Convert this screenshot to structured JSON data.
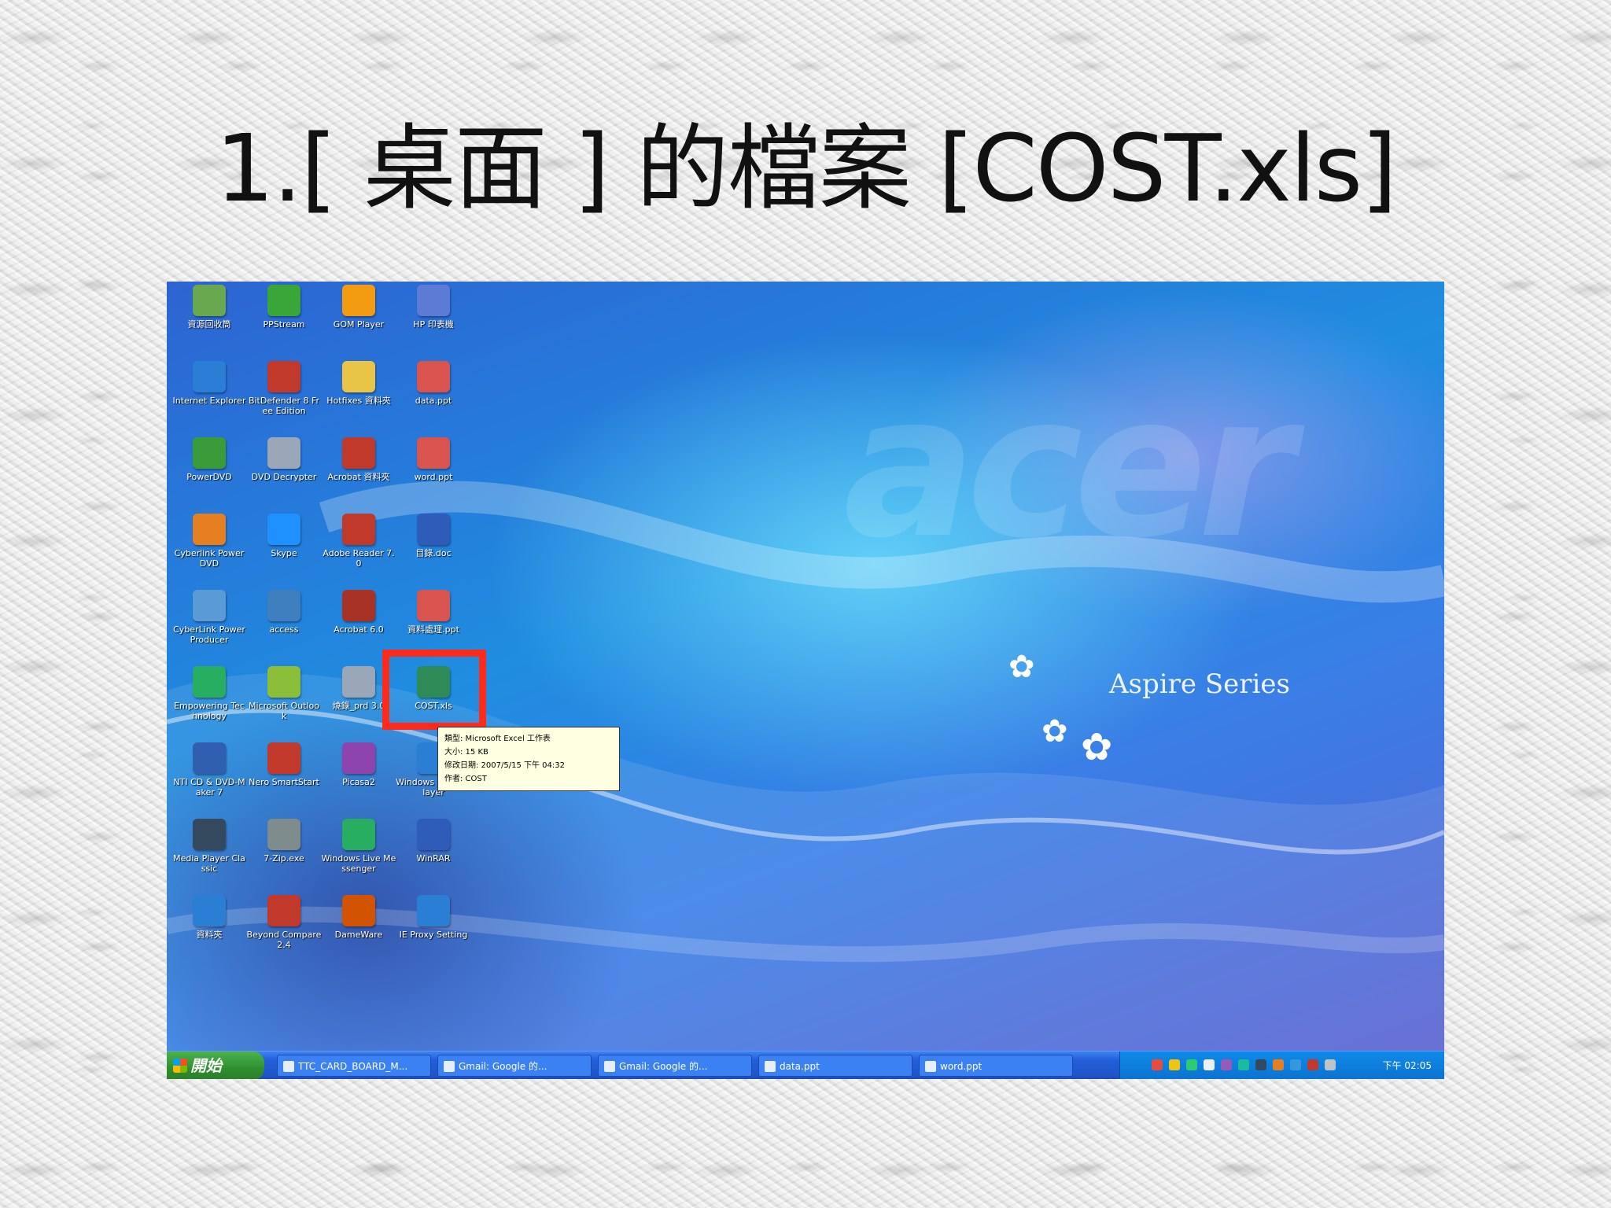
{
  "slide": {
    "title": "1.[ 桌面 ] 的檔案 [COST.xls]"
  },
  "desktop": {
    "brand": "acer",
    "series": "Aspire Series",
    "icons": [
      {
        "label": "資源回收筒",
        "icon": "recycle-bin-icon",
        "color": "#6aa84f"
      },
      {
        "label": "PPStream",
        "icon": "ppstream-icon",
        "color": "#3aa63a"
      },
      {
        "label": "GOM Player",
        "icon": "gom-player-icon",
        "color": "#f39c12"
      },
      {
        "label": "HP 印表機",
        "icon": "printer-icon",
        "color": "#5b7bd5"
      },
      {
        "label": "Internet Explorer",
        "icon": "internet-explorer-icon",
        "color": "#2a7fd4"
      },
      {
        "label": "BitDefender 8 Free Edition",
        "icon": "bitdefender-icon",
        "color": "#c0392b"
      },
      {
        "label": "Hotfixes 資料夾",
        "icon": "folder-icon",
        "color": "#e8c547"
      },
      {
        "label": "data.ppt",
        "icon": "powerpoint-file-icon",
        "color": "#d9534f"
      },
      {
        "label": "PowerDVD",
        "icon": "powerdvd-icon",
        "color": "#3a9b3a"
      },
      {
        "label": "DVD Decrypter",
        "icon": "disc-icon",
        "color": "#9aa7b8"
      },
      {
        "label": "Acrobat 資料夾",
        "icon": "acrobat-icon",
        "color": "#c0392b"
      },
      {
        "label": "word.ppt",
        "icon": "powerpoint-file-icon",
        "color": "#d9534f"
      },
      {
        "label": "Cyberlink PowerDVD",
        "icon": "cyberlink-icon",
        "color": "#e67e22"
      },
      {
        "label": "Skype",
        "icon": "skype-icon",
        "color": "#1e90ff"
      },
      {
        "label": "Adobe Reader 7.0",
        "icon": "adobe-reader-icon",
        "color": "#c0392b"
      },
      {
        "label": "目錄.doc",
        "icon": "word-file-icon",
        "color": "#2e5cb8"
      },
      {
        "label": "CyberLink PowerProducer",
        "icon": "powerproducer-icon",
        "color": "#5b9bd5"
      },
      {
        "label": "access",
        "icon": "network-icon",
        "color": "#3f7fbf"
      },
      {
        "label": "Acrobat 6.0",
        "icon": "acrobat-icon",
        "color": "#a93226"
      },
      {
        "label": "資料處理.ppt",
        "icon": "powerpoint-file-icon",
        "color": "#d9534f"
      },
      {
        "label": "Empowering Technology",
        "icon": "empowering-icon",
        "color": "#27ae60"
      },
      {
        "label": "Microsoft Outlook",
        "icon": "outlook-icon",
        "color": "#8bbf3a"
      },
      {
        "label": "燒錄_prd 3.0",
        "icon": "disc-icon",
        "color": "#9aa7b8"
      },
      {
        "label": "COST.xls",
        "icon": "excel-file-icon",
        "color": "#2e8b57"
      },
      {
        "label": "NTI CD & DVD-Maker 7",
        "icon": "nti-icon",
        "color": "#2f5fae"
      },
      {
        "label": "Nero SmartStart",
        "icon": "nero-icon",
        "color": "#c0392b"
      },
      {
        "label": "Picasa2",
        "icon": "picasa-icon",
        "color": "#8e44ad"
      },
      {
        "label": "Windows Media Player",
        "icon": "media-player-icon",
        "color": "#2a7fd4"
      },
      {
        "label": "Media Player Classic",
        "icon": "media-player-classic-icon",
        "color": "#34495e"
      },
      {
        "label": "7-Zip.exe",
        "icon": "zip-icon",
        "color": "#7f8c8d"
      },
      {
        "label": "Windows Live Messenger",
        "icon": "messenger-icon",
        "color": "#27ae60"
      },
      {
        "label": "WinRAR",
        "icon": "winrar-icon",
        "color": "#2e5cb8"
      },
      {
        "label": "資料夾",
        "icon": "folder-shortcut-icon",
        "color": "#2a7fd4"
      },
      {
        "label": "Beyond Compare 2.4",
        "icon": "beyond-compare-icon",
        "color": "#c0392b"
      },
      {
        "label": "DameWare",
        "icon": "dameware-icon",
        "color": "#d35400"
      },
      {
        "label": "IE Proxy Setting",
        "icon": "proxy-icon",
        "color": "#2a7fd4"
      }
    ],
    "tooltip": {
      "lines": [
        "類型: Microsoft Excel 工作表",
        "大小: 15 KB",
        "修改日期: 2007/5/15 下午 04:32",
        "作者: COST"
      ]
    }
  },
  "taskbar": {
    "start_label": "開始",
    "tasks": [
      "TTC_CARD_BOARD_M...",
      "Gmail: Google 的...",
      "Gmail: Google 的...",
      "data.ppt",
      "word.ppt"
    ],
    "clock": "下午 02:05"
  }
}
